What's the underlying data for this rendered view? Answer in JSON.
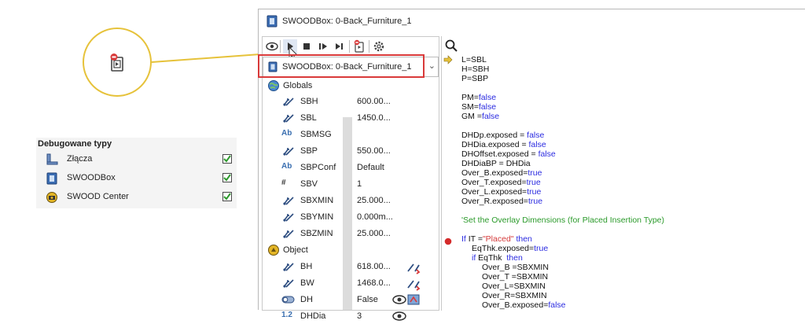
{
  "debug_panel": {
    "title": "Debugowane typy",
    "items": [
      {
        "label": "Złącza",
        "icon": "connector-icon",
        "checked": true
      },
      {
        "label": "SWOODBox",
        "icon": "swoodbox-icon",
        "checked": true
      },
      {
        "label": "SWOOD Center",
        "icon": "swood-center-icon",
        "checked": true
      }
    ]
  },
  "window": {
    "title": "SWOODBox: 0-Back_Furniture_1",
    "combo_value": "SWOODBox: 0-Back_Furniture_1",
    "globals_label": "Globals",
    "object_label": "Object",
    "globals": [
      {
        "name": "SBH",
        "value": "600.00...",
        "icon": "parameter-icon"
      },
      {
        "name": "SBL",
        "value": "1450.0...",
        "icon": "parameter-icon"
      },
      {
        "name": "SBMSG",
        "value": "",
        "icon": "text-icon",
        "icon_text": "Ab"
      },
      {
        "name": "SBP",
        "value": "550.00...",
        "icon": "parameter-icon"
      },
      {
        "name": "SBPConf",
        "value": "Default",
        "icon": "text-icon",
        "icon_text": "Ab"
      },
      {
        "name": "SBV",
        "value": "1",
        "icon": "number-icon",
        "icon_text": "#"
      },
      {
        "name": "SBXMIN",
        "value": "25.000...",
        "icon": "parameter-icon"
      },
      {
        "name": "SBYMIN",
        "value": "0.000m...",
        "icon": "parameter-icon"
      },
      {
        "name": "SBZMIN",
        "value": "25.000...",
        "icon": "parameter-icon"
      }
    ],
    "object": [
      {
        "name": "BH",
        "value": "618.00...",
        "icon": "parameter-icon"
      },
      {
        "name": "BW",
        "value": "1468.0...",
        "icon": "parameter-icon"
      },
      {
        "name": "DH",
        "value": "False",
        "icon": "toggle-icon"
      },
      {
        "name": "DHDia",
        "value": "3",
        "icon": "number-icon",
        "icon_text": "1.2"
      }
    ]
  },
  "code_lines": [
    {
      "parts": [
        {
          "t": "L=SBL"
        }
      ],
      "indent": 0
    },
    {
      "parts": [
        {
          "t": "H=SBH"
        }
      ],
      "indent": 0
    },
    {
      "parts": [
        {
          "t": "P=SBP"
        }
      ],
      "indent": 0
    },
    {
      "parts": [],
      "indent": 0
    },
    {
      "parts": [
        {
          "t": "PM="
        },
        {
          "t": "false",
          "c": "kw"
        }
      ],
      "indent": 0
    },
    {
      "parts": [
        {
          "t": "SM="
        },
        {
          "t": "false",
          "c": "kw"
        }
      ],
      "indent": 0
    },
    {
      "parts": [
        {
          "t": "GM ="
        },
        {
          "t": "false",
          "c": "kw"
        }
      ],
      "indent": 0
    },
    {
      "parts": [],
      "indent": 0
    },
    {
      "parts": [
        {
          "t": "DHDp.exposed = "
        },
        {
          "t": "false",
          "c": "kw"
        }
      ],
      "indent": 0
    },
    {
      "parts": [
        {
          "t": "DHDia.exposed = "
        },
        {
          "t": "false",
          "c": "kw"
        }
      ],
      "indent": 0
    },
    {
      "parts": [
        {
          "t": "DHOffset.exposed = "
        },
        {
          "t": "false",
          "c": "kw"
        }
      ],
      "indent": 0
    },
    {
      "parts": [
        {
          "t": "DHDiaBP = DHDia"
        }
      ],
      "indent": 0
    },
    {
      "parts": [
        {
          "t": "Over_B.exposed="
        },
        {
          "t": "true",
          "c": "kw"
        }
      ],
      "indent": 0
    },
    {
      "parts": [
        {
          "t": "Over_T.exposed="
        },
        {
          "t": "true",
          "c": "kw"
        }
      ],
      "indent": 0
    },
    {
      "parts": [
        {
          "t": "Over_L.exposed="
        },
        {
          "t": "true",
          "c": "kw"
        }
      ],
      "indent": 0
    },
    {
      "parts": [
        {
          "t": "Over_R.exposed="
        },
        {
          "t": "true",
          "c": "kw"
        }
      ],
      "indent": 0
    },
    {
      "parts": [],
      "indent": 0
    },
    {
      "parts": [
        {
          "t": "'Set the Overlay Dimensions (for Placed Insertion Type)",
          "c": "cm"
        }
      ],
      "indent": 0
    },
    {
      "parts": [],
      "indent": 0
    },
    {
      "parts": [
        {
          "t": "If",
          "c": "kw"
        },
        {
          "t": " IT ="
        },
        {
          "t": "\"Placed\"",
          "c": "str"
        },
        {
          "t": " "
        },
        {
          "t": "then",
          "c": "kw"
        }
      ],
      "indent": 0
    },
    {
      "parts": [
        {
          "t": "EqThk.exposed="
        },
        {
          "t": "true",
          "c": "kw"
        }
      ],
      "indent": 1
    },
    {
      "parts": [
        {
          "t": "if",
          "c": "kw"
        },
        {
          "t": " EqThk  "
        },
        {
          "t": "then",
          "c": "kw"
        }
      ],
      "indent": 1
    },
    {
      "parts": [
        {
          "t": "Over_B =SBXMIN"
        }
      ],
      "indent": 2
    },
    {
      "parts": [
        {
          "t": "Over_T =SBXMIN"
        }
      ],
      "indent": 2
    },
    {
      "parts": [
        {
          "t": "Over_L=SBXMIN"
        }
      ],
      "indent": 2
    },
    {
      "parts": [
        {
          "t": "Over_R=SBXMIN"
        }
      ],
      "indent": 2
    },
    {
      "parts": [
        {
          "t": "Over_B.exposed="
        },
        {
          "t": "false",
          "c": "kw"
        }
      ],
      "indent": 2
    }
  ],
  "colors": {
    "callout": "#e6c23a",
    "highlight": "#d93a3a",
    "keyword": "#2a2ae0",
    "string": "#d43a3a",
    "comment": "#2a9a2a",
    "checkbox": "#2e9a2e"
  }
}
